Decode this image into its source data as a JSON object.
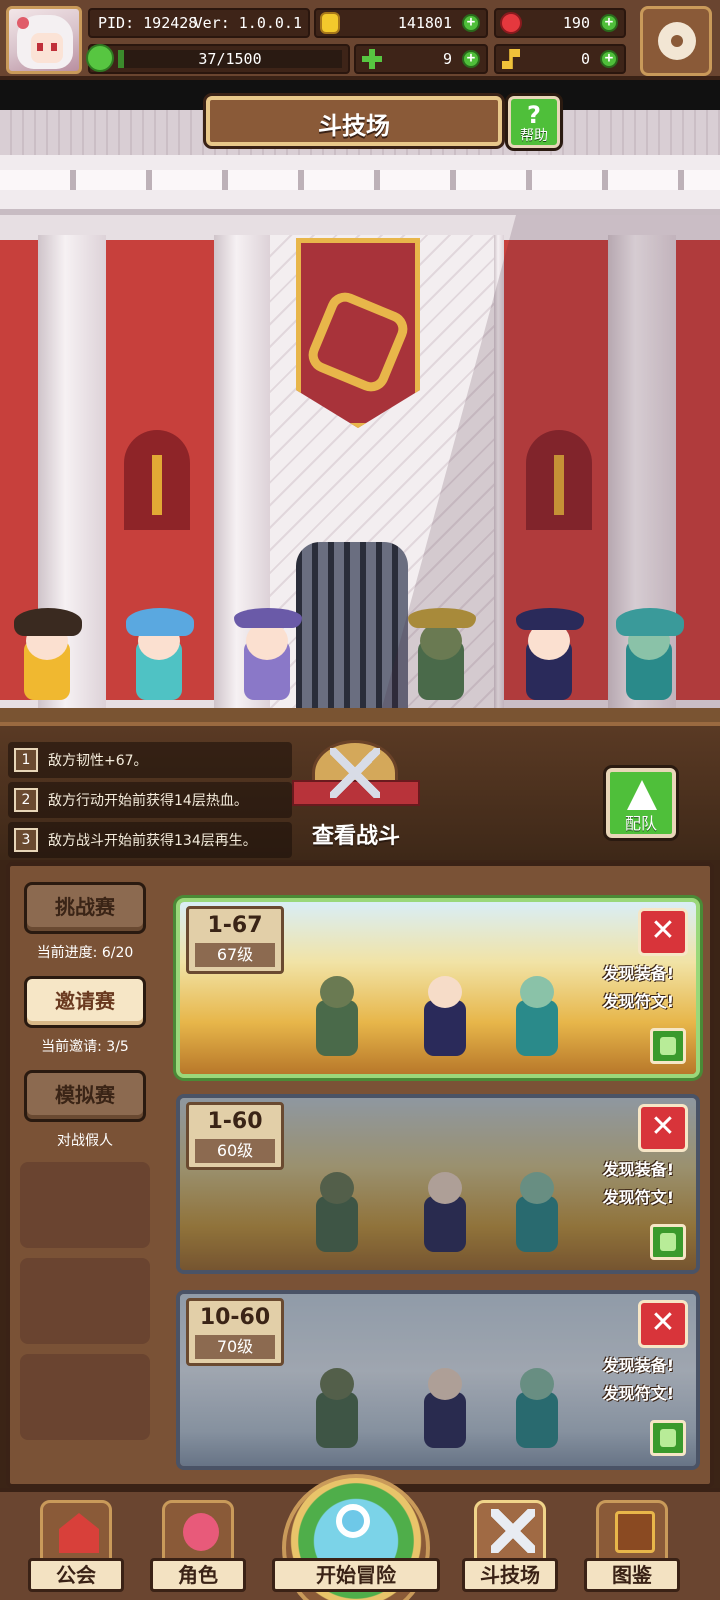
{
  "status_bar": {
    "pid": "PID: 192428",
    "version": "Ver: 1.0.0.1",
    "gold": "141801",
    "gems": "190",
    "stamina": "37/1500",
    "stamina_fraction": 0.025,
    "clover": "9",
    "keys": "0"
  },
  "header": {
    "title": "斗技场",
    "help_label": "帮助",
    "help_icon": "?"
  },
  "enemy_buffs": [
    {
      "num": "1",
      "text": "敌方韧性+67。"
    },
    {
      "num": "2",
      "text": "敌方行动开始前获得14层热血。"
    },
    {
      "num": "3",
      "text": "敌方战斗开始前获得134层再生。"
    }
  ],
  "view_battle_label": "查看战斗",
  "formation_label": "配队",
  "sidebar": {
    "challenge": {
      "label": "挑战赛",
      "sub": "当前进度: 6/20"
    },
    "invite": {
      "label": "邀请赛",
      "sub": "当前邀请: 3/5"
    },
    "simulate": {
      "label": "模拟赛",
      "sub": "对战假人"
    }
  },
  "opponents": [
    {
      "stage": "1-67",
      "level": "67级",
      "find1": "发现装备!",
      "find2": "发现符文!",
      "close": "✕"
    },
    {
      "stage": "1-60",
      "level": "60级",
      "find1": "发现装备!",
      "find2": "发现符文!",
      "close": "✕"
    },
    {
      "stage": "10-60",
      "level": "70级",
      "find1": "发现装备!",
      "find2": "发现符文!",
      "close": "✕"
    }
  ],
  "nav": {
    "guild": "公会",
    "character": "角色",
    "adventure": "开始冒险",
    "arena": "斗技场",
    "codex": "图鉴"
  },
  "colors": {
    "accent_green": "#4fbf3a",
    "danger_red": "#d8343a",
    "panel_brown": "#7a5236",
    "parchment": "#f3e2c2"
  }
}
